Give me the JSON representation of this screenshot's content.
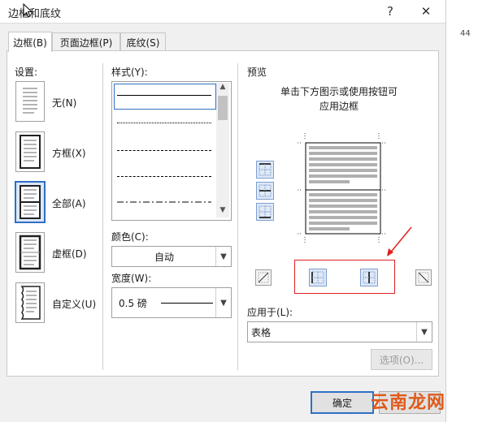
{
  "dialog": {
    "title": "边框和底纹",
    "help_glyph": "?",
    "close_glyph": "✕"
  },
  "background": {
    "page_number": "44"
  },
  "tabs": [
    {
      "label": "边框(B)",
      "active": true
    },
    {
      "label": "页面边框(P)",
      "active": false
    },
    {
      "label": "底纹(S)",
      "active": false
    }
  ],
  "settings": {
    "heading": "设置:",
    "options": [
      {
        "label": "无(N)",
        "icon": "none-border-icon",
        "selected": false
      },
      {
        "label": "方框(X)",
        "icon": "box-border-icon",
        "selected": false
      },
      {
        "label": "全部(A)",
        "icon": "all-borders-icon",
        "selected": true
      },
      {
        "label": "虚框(D)",
        "icon": "grid-border-icon",
        "selected": false
      },
      {
        "label": "自定义(U)",
        "icon": "custom-border-icon",
        "selected": false
      }
    ]
  },
  "style": {
    "heading": "样式(Y):",
    "color_label": "颜色(C):",
    "color_value": "自动",
    "width_label": "宽度(W):",
    "width_value": "0.5 磅"
  },
  "preview": {
    "heading": "预览",
    "instruction_line1": "单击下方图示或使用按钮可",
    "instruction_line2": "应用边框",
    "apply_to_label": "应用于(L):",
    "apply_to_value": "表格",
    "options_button": "选项(O)..."
  },
  "footer": {
    "ok_label": "确定"
  },
  "watermark": {
    "text": "云南龙网"
  },
  "colors": {
    "accent": "#2f6fc5",
    "annotation_red": "#e02020",
    "watermark": "#e05a1a"
  }
}
